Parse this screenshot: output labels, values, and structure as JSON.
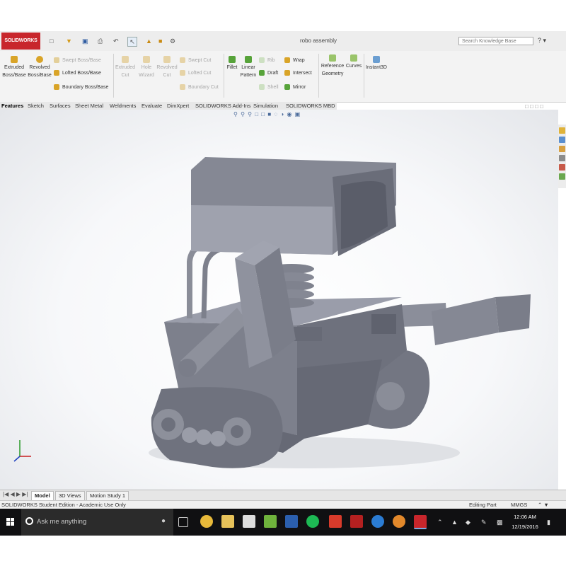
{
  "window": {
    "title": "robo assembly",
    "search_placeholder": "Search Knowledge Base",
    "logo": "SOLIDWORKS"
  },
  "commands": {
    "extruded_boss": "Extruded Boss/Base",
    "revolved_boss": "Revolved Boss/Base",
    "swept_boss": "Swept Boss/Base",
    "lofted_boss": "Lofted Boss/Base",
    "boundary_boss": "Boundary Boss/Base",
    "extruded_cut": "Extruded Cut",
    "hole_wizard": "Hole Wizard",
    "revolved_cut": "Revolved Cut",
    "swept_cut": "Swept Cut",
    "lofted_cut": "Lofted Cut",
    "boundary_cut": "Boundary Cut",
    "fillet": "Fillet",
    "linear_pattern": "Linear Pattern",
    "rib": "Rib",
    "draft": "Draft",
    "shell": "Shell",
    "wrap": "Wrap",
    "intersect": "Intersect",
    "mirror": "Mirror",
    "reference_geometry": "Reference Geometry",
    "curves": "Curves",
    "instant3d": "Instant3D"
  },
  "tabs": [
    "Features",
    "Sketch",
    "Surfaces",
    "Sheet Metal",
    "Weldments",
    "Evaluate",
    "DimXpert",
    "SOLIDWORKS Add-Ins",
    "Simulation",
    "SOLIDWORKS MBD"
  ],
  "bottom_tabs": [
    "Model",
    "3D Views",
    "Motion Study 1"
  ],
  "status": {
    "edition": "SOLIDWORKS Student Edition - Academic Use Only",
    "mode": "Editing Part",
    "units": "MMGS"
  },
  "taskbar": {
    "search_placeholder": "Ask me anything",
    "time": "12:06 AM",
    "date": "12/19/2016"
  },
  "colors": {
    "model": "#7d808c",
    "accent_red": "#c8262c",
    "taskbar": "#101012"
  },
  "icons": [
    "solidworks-logo-icon",
    "new-file-icon",
    "open-icon",
    "save-icon",
    "print-icon",
    "undo-icon",
    "select-icon",
    "rebuild-icon",
    "options-icon",
    "help-icon",
    "windows-start-icon",
    "microphone-icon",
    "task-view-icon",
    "chrome-icon",
    "file-explorer-icon",
    "store-icon",
    "edge-icon",
    "word-icon",
    "spotify-icon",
    "solidworks-taskbar-icon"
  ]
}
